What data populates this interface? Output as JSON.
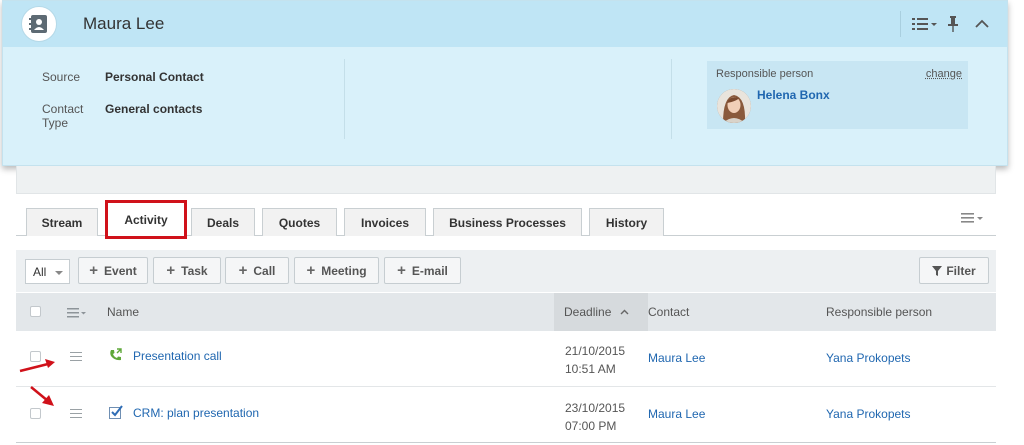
{
  "card": {
    "title": "Maura Lee",
    "fields": [
      {
        "label": "Source",
        "value": "Personal Contact"
      },
      {
        "label": "Contact Type",
        "value": "General contacts"
      }
    ],
    "responsible": {
      "label": "Responsible person",
      "change_label": "change",
      "name": "Helena Bonx"
    }
  },
  "tabs": [
    {
      "label": "Stream",
      "active": false
    },
    {
      "label": "Activity",
      "active": true
    },
    {
      "label": "Deals",
      "active": false
    },
    {
      "label": "Quotes",
      "active": false
    },
    {
      "label": "Invoices",
      "active": false
    },
    {
      "label": "Business Processes",
      "active": false
    },
    {
      "label": "History",
      "active": false
    }
  ],
  "toolbar": {
    "filter_select": "All",
    "buttons": [
      "Event",
      "Task",
      "Call",
      "Meeting",
      "E-mail"
    ],
    "filter_label": "Filter"
  },
  "grid": {
    "columns": {
      "name": "Name",
      "deadline": "Deadline",
      "contact": "Contact",
      "responsible": "Responsible person"
    },
    "rows": [
      {
        "type_icon": "phone-call-icon",
        "name": "Presentation call",
        "date": "21/10/2015",
        "time": "10:51 AM",
        "contact": "Maura Lee",
        "responsible": "Yana Prokopets"
      },
      {
        "type_icon": "task-checkbox-icon",
        "name": "CRM: plan presentation",
        "date": "23/10/2015",
        "time": "07:00 PM",
        "contact": "Maura Lee",
        "responsible": "Yana Prokopets"
      }
    ]
  },
  "colors": {
    "accent_link": "#2067b0",
    "header_bg": "#bfe5f5",
    "card_bg": "#d9f1fa",
    "highlight_red": "#d0111a"
  }
}
